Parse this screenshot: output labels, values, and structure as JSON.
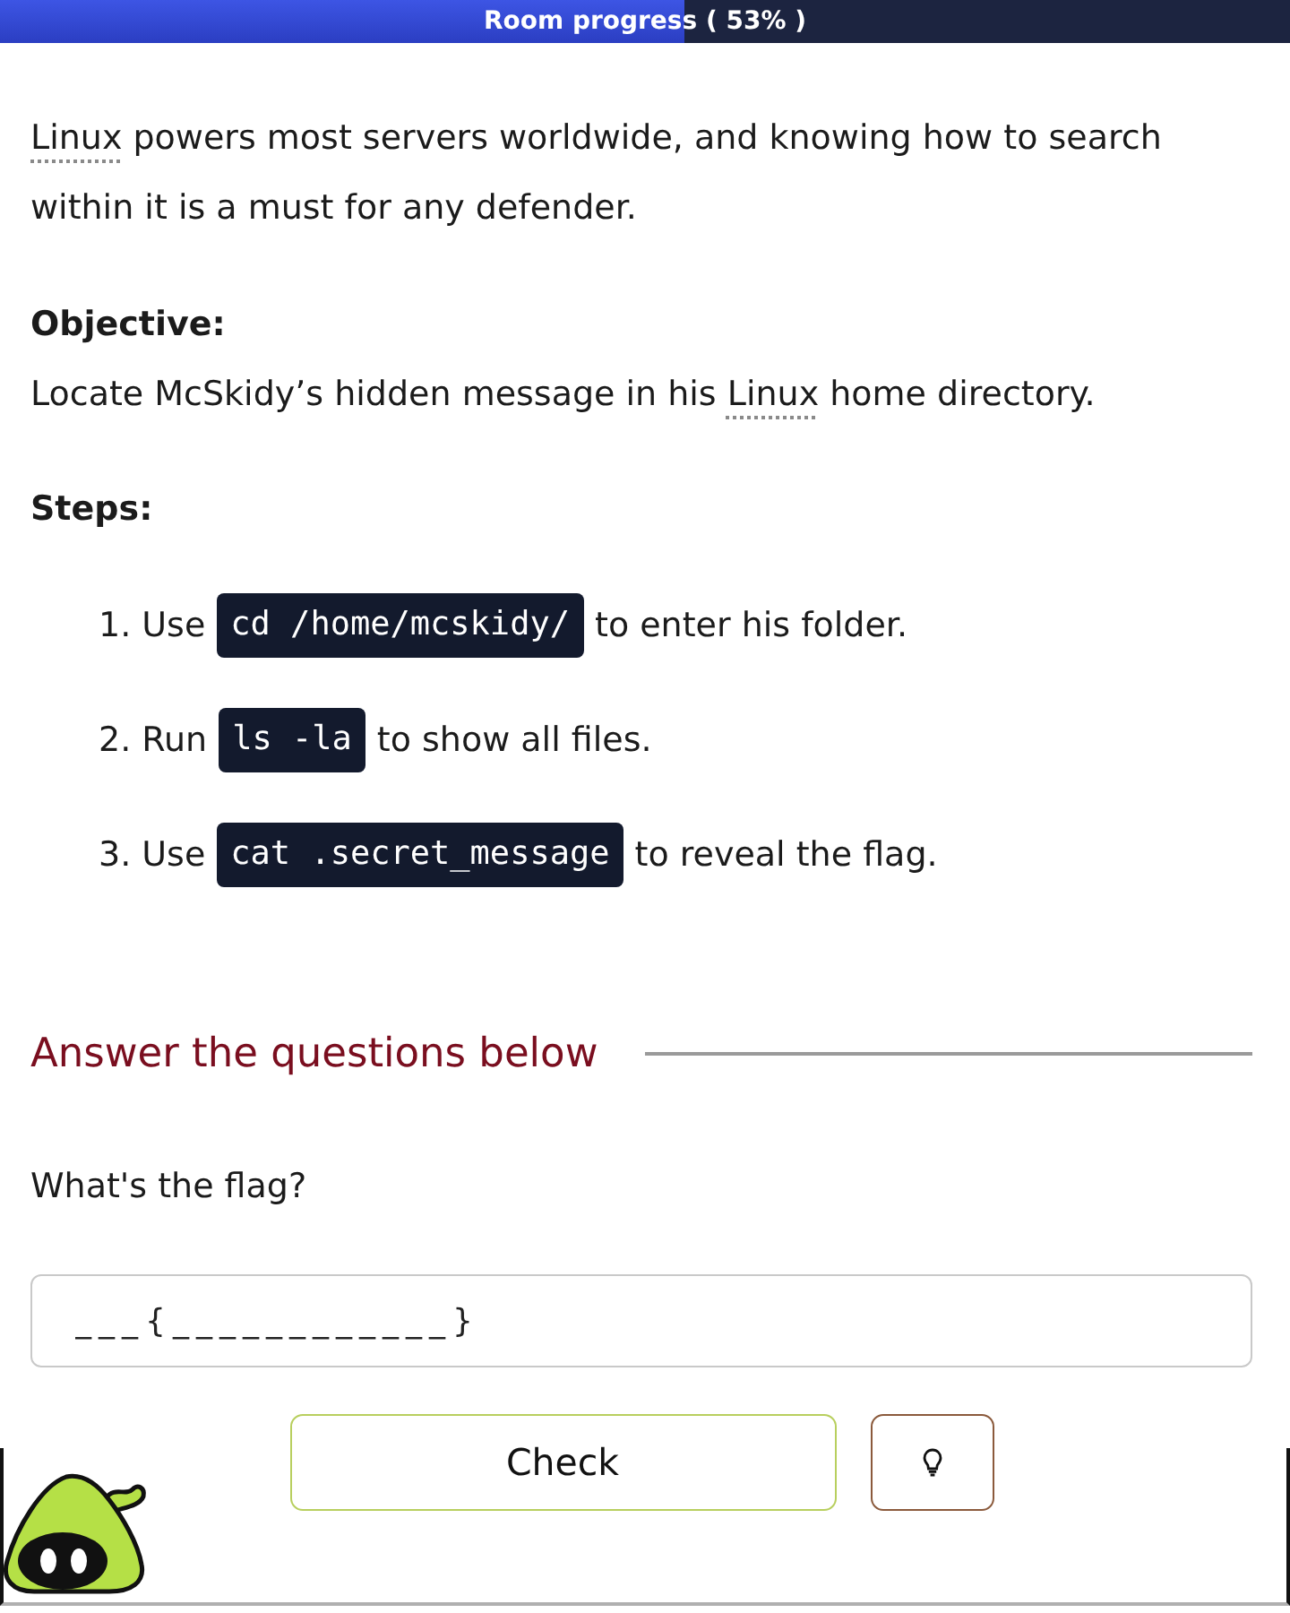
{
  "progress": {
    "label": "Room progress ( 53% )",
    "level": 0.53
  },
  "intro": {
    "segments": [
      {
        "text": "Linux",
        "kind": "term"
      },
      {
        "text": " powers most servers worldwide, and knowing how to search within it is a must for any defender.",
        "kind": "plain"
      }
    ]
  },
  "objective": {
    "heading": "Objective:",
    "segments": [
      {
        "text": "Locate McSkidy’s hidden message in his ",
        "kind": "plain"
      },
      {
        "text": "Linux",
        "kind": "term"
      },
      {
        "text": " home directory.",
        "kind": "plain"
      }
    ]
  },
  "steps": {
    "heading": "Steps:",
    "items": [
      {
        "number": "1.",
        "before": "Use",
        "code": "cd /home/mcskidy/",
        "after": "to enter his folder."
      },
      {
        "number": "2.",
        "before": "Run",
        "code": "ls -la",
        "after": "to show all files."
      },
      {
        "number": "3.",
        "before": "Use",
        "code": "cat .secret_message",
        "after": "to reveal the flag."
      }
    ]
  },
  "questions": {
    "heading": "Answer the questions below",
    "items": [
      {
        "question": "What's the flag?",
        "placeholder": "___{____________}",
        "submit": "Check"
      }
    ]
  }
}
